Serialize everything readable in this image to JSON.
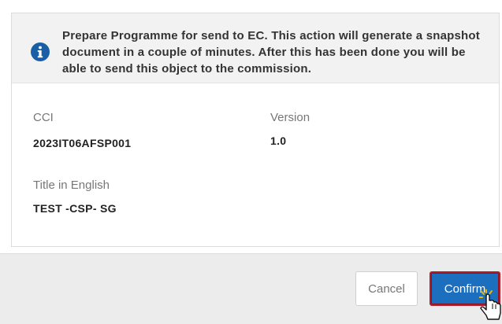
{
  "info": {
    "message": "Prepare Programme for send to EC. This action will generate a snapshot document in a couple of minutes. After this has been done you will be able to send this object to the commission.",
    "icon": "info-icon"
  },
  "fields": {
    "cci_label": "CCI",
    "cci_value": "2023IT06AFSP001",
    "version_label": "Version",
    "version_value": "1.0",
    "title_label": "Title in English",
    "title_value": "TEST -CSP- SG"
  },
  "buttons": {
    "cancel_label": "Cancel",
    "confirm_label": "Confirm"
  },
  "colors": {
    "info_icon": "#1a5fa6",
    "confirm_bg": "#1c6fbf",
    "confirm_border": "#b11c2c"
  }
}
